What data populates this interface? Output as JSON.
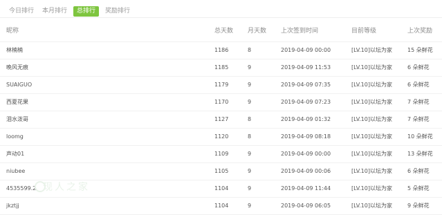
{
  "tabs": [
    {
      "label": "今日排行",
      "active": false
    },
    {
      "label": "本月排行",
      "active": false
    },
    {
      "label": "总排行",
      "active": true
    },
    {
      "label": "奖励排行",
      "active": false
    }
  ],
  "colors": {
    "accent": "#7ec53f"
  },
  "table": {
    "headers": [
      "昵称",
      "总天数",
      "月天数",
      "上次签到时间",
      "目前等级",
      "上次奖励"
    ],
    "rows": [
      [
        "林楠楠",
        "1186",
        "8",
        "2019-04-09 00:00",
        "[LV.10]以坛为家",
        "15 朵鲜花"
      ],
      [
        "晚风无痕",
        "1185",
        "9",
        "2019-04-09 11:53",
        "[LV.10]以坛为家",
        "6 朵鲜花"
      ],
      [
        "SUAIGUO",
        "1179",
        "9",
        "2019-04-09 07:35",
        "[LV.10]以坛为家",
        "6 朵鲜花"
      ],
      [
        "西夏花果",
        "1170",
        "9",
        "2019-04-09 07:23",
        "[LV.10]以坛为家",
        "7 朵鲜花"
      ],
      [
        "泪水泼哥",
        "1127",
        "8",
        "2019-04-09 01:32",
        "[LV.10]以坛为家",
        "7 朵鲜花"
      ],
      [
        "loomg",
        "1120",
        "8",
        "2019-04-09 08:18",
        "[LV.10]以坛为家",
        "10 朵鲜花"
      ],
      [
        "声动01",
        "1109",
        "9",
        "2019-04-09 00:00",
        "[LV.10]以坛为家",
        "13 朵鲜花"
      ],
      [
        "niubee",
        "1105",
        "9",
        "2019-04-09 00:06",
        "[LV.10]以坛为家",
        "6 朵鲜花"
      ],
      [
        "4535599.2",
        "1104",
        "9",
        "2019-04-09 11:44",
        "[LV.10]以坛为家",
        "5 朵鲜花"
      ],
      [
        "jkztjj",
        "1104",
        "9",
        "2019-04-09 06:05",
        "[LV.10]以坛为家",
        "9 朵鲜花"
      ]
    ]
  },
  "watermark": "现人之家"
}
